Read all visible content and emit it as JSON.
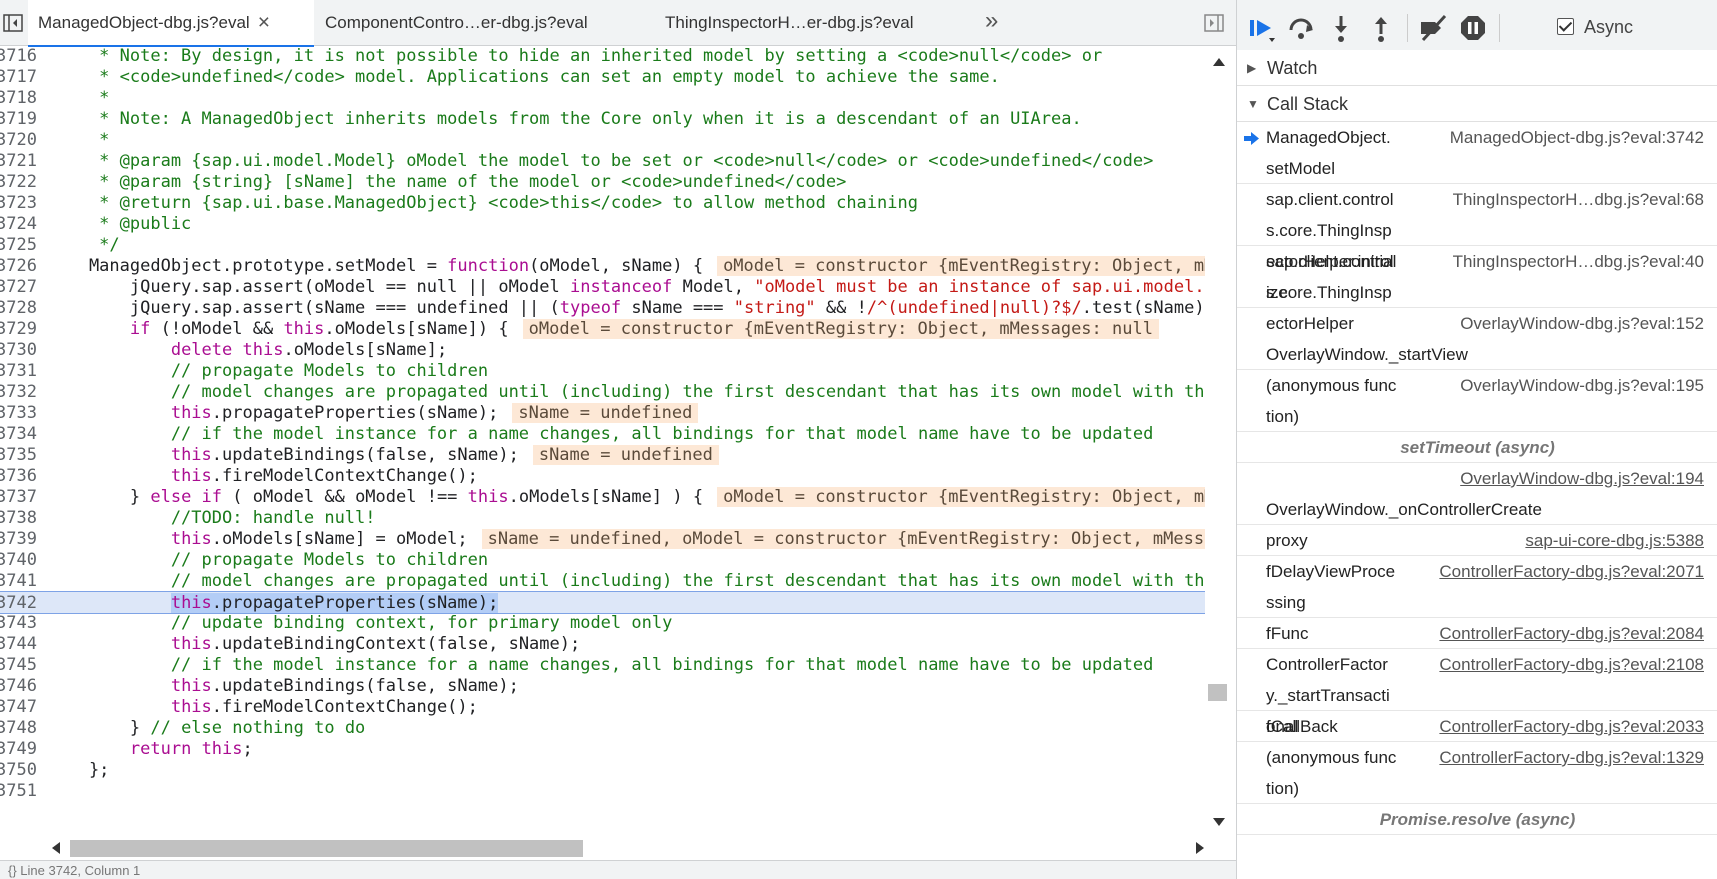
{
  "tabs": [
    {
      "label": "ManagedObject-dbg.js?eval",
      "active": true
    },
    {
      "label": "ComponentContro…er-dbg.js?eval",
      "active": false
    },
    {
      "label": "ThingInspectorH…er-dbg.js?eval",
      "active": false
    }
  ],
  "code": [
    {
      "n": "3716",
      "segs": [
        {
          "t": "     * Note: By design, it is not possible to hide an inherited model by setting a <code>null</code> or",
          "c": "cm"
        }
      ]
    },
    {
      "n": "3717",
      "segs": [
        {
          "t": "     * <code>undefined</code> model. Applications can set an empty model to achieve the same.",
          "c": "cm"
        }
      ]
    },
    {
      "n": "3718",
      "segs": [
        {
          "t": "     *",
          "c": "cm"
        }
      ]
    },
    {
      "n": "3719",
      "segs": [
        {
          "t": "     * Note: A ManagedObject inherits models from the Core only when it is a descendant of an UIArea.",
          "c": "cm"
        }
      ]
    },
    {
      "n": "3720",
      "segs": [
        {
          "t": "     *",
          "c": "cm"
        }
      ]
    },
    {
      "n": "3721",
      "segs": [
        {
          "t": "     * @param {sap.ui.model.Model} oModel the model to be set or <code>null</code> or <code>undefined</code>",
          "c": "cm"
        }
      ]
    },
    {
      "n": "3722",
      "segs": [
        {
          "t": "     * @param {string} [sName] the name of the model or <code>undefined</code>",
          "c": "cm"
        }
      ]
    },
    {
      "n": "3723",
      "segs": [
        {
          "t": "     * @return {sap.ui.base.ManagedObject} <code>this</code> to allow method chaining",
          "c": "cm"
        }
      ]
    },
    {
      "n": "3724",
      "segs": [
        {
          "t": "     * @public",
          "c": "cm"
        }
      ]
    },
    {
      "n": "3725",
      "segs": [
        {
          "t": "     */",
          "c": "cm"
        }
      ]
    },
    {
      "n": "3726",
      "segs": [
        {
          "t": "    ManagedObject.prototype.setModel = ",
          "c": ""
        },
        {
          "t": "function",
          "c": "kw"
        },
        {
          "t": "(oModel, sName) {",
          "c": ""
        }
      ],
      "val": "oModel = constructor {mEventRegistry: Object, mMessages: null"
    },
    {
      "n": "3727",
      "segs": [
        {
          "t": "        jQuery.sap.assert(oModel == null || oModel ",
          "c": ""
        },
        {
          "t": "instanceof",
          "c": "kw"
        },
        {
          "t": " Model, ",
          "c": ""
        },
        {
          "t": "\"oModel must be an instance of sap.ui.model.Model\"",
          "c": "str"
        }
      ]
    },
    {
      "n": "3728",
      "segs": [
        {
          "t": "        jQuery.sap.assert(sName === undefined || (",
          "c": ""
        },
        {
          "t": "typeof",
          "c": "kw"
        },
        {
          "t": " sName === ",
          "c": ""
        },
        {
          "t": "\"string\"",
          "c": "str"
        },
        {
          "t": " && !",
          "c": ""
        },
        {
          "t": "/^(undefined|null)?$/",
          "c": "str"
        },
        {
          "t": ".test(sName))",
          "c": ""
        }
      ]
    },
    {
      "n": "3729",
      "segs": [
        {
          "t": "        ",
          "c": ""
        },
        {
          "t": "if",
          "c": "kw"
        },
        {
          "t": " (!oModel && ",
          "c": ""
        },
        {
          "t": "this",
          "c": "kw"
        },
        {
          "t": ".oModels[sName]) {",
          "c": ""
        }
      ],
      "val": "oModel = constructor {mEventRegistry: Object, mMessages: null"
    },
    {
      "n": "3730",
      "segs": [
        {
          "t": "            ",
          "c": ""
        },
        {
          "t": "delete",
          "c": "kw"
        },
        {
          "t": " ",
          "c": ""
        },
        {
          "t": "this",
          "c": "kw"
        },
        {
          "t": ".oModels[sName];",
          "c": ""
        }
      ]
    },
    {
      "n": "3731",
      "segs": [
        {
          "t": "            // propagate Models to children",
          "c": "cm"
        }
      ]
    },
    {
      "n": "3732",
      "segs": [
        {
          "t": "            // model changes are propagated until (including) the first descendant that has its own model with the same name",
          "c": "cm"
        }
      ]
    },
    {
      "n": "3733",
      "segs": [
        {
          "t": "            ",
          "c": ""
        },
        {
          "t": "this",
          "c": "kw"
        },
        {
          "t": ".propagateProperties(sName);",
          "c": ""
        }
      ],
      "val": "sName = undefined"
    },
    {
      "n": "3734",
      "segs": [
        {
          "t": "            // if the model instance for a name changes, all bindings for that model name have to be updated",
          "c": "cm"
        }
      ]
    },
    {
      "n": "3735",
      "segs": [
        {
          "t": "            ",
          "c": ""
        },
        {
          "t": "this",
          "c": "kw"
        },
        {
          "t": ".updateBindings(false, sName);",
          "c": ""
        }
      ],
      "val": "sName = undefined"
    },
    {
      "n": "3736",
      "segs": [
        {
          "t": "            ",
          "c": ""
        },
        {
          "t": "this",
          "c": "kw"
        },
        {
          "t": ".fireModelContextChange();",
          "c": ""
        }
      ]
    },
    {
      "n": "3737",
      "segs": [
        {
          "t": "        } ",
          "c": ""
        },
        {
          "t": "else if",
          "c": "kw"
        },
        {
          "t": " ( oModel && oModel !== ",
          "c": ""
        },
        {
          "t": "this",
          "c": "kw"
        },
        {
          "t": ".oModels[sName] ) {",
          "c": ""
        }
      ],
      "val": "oModel = constructor {mEventRegistry: Object, mMessages: null"
    },
    {
      "n": "3738",
      "segs": [
        {
          "t": "            //TODO: handle null!",
          "c": "cm"
        }
      ]
    },
    {
      "n": "3739",
      "segs": [
        {
          "t": "            ",
          "c": ""
        },
        {
          "t": "this",
          "c": "kw"
        },
        {
          "t": ".oModels[sName] = oModel;",
          "c": ""
        }
      ],
      "val": "sName = undefined, oModel = constructor {mEventRegistry: Object, mMessages: null"
    },
    {
      "n": "3740",
      "segs": [
        {
          "t": "            // propagate Models to children",
          "c": "cm"
        }
      ]
    },
    {
      "n": "3741",
      "segs": [
        {
          "t": "            // model changes are propagated until (including) the first descendant that has its own model with the same name",
          "c": "cm"
        }
      ]
    },
    {
      "n": "3742",
      "exec": true,
      "segs": [
        {
          "t": "            ",
          "c": ""
        },
        {
          "t": "this",
          "c": "kw hl"
        },
        {
          "t": ".propagateProperties(sName);",
          "c": "hl"
        }
      ]
    },
    {
      "n": "3743",
      "segs": [
        {
          "t": "            // update binding context, for primary model only",
          "c": "cm"
        }
      ]
    },
    {
      "n": "3744",
      "segs": [
        {
          "t": "            ",
          "c": ""
        },
        {
          "t": "this",
          "c": "kw"
        },
        {
          "t": ".updateBindingContext(false, sName);",
          "c": ""
        }
      ]
    },
    {
      "n": "3745",
      "segs": [
        {
          "t": "            // if the model instance for a name changes, all bindings for that model name have to be updated",
          "c": "cm"
        }
      ]
    },
    {
      "n": "3746",
      "segs": [
        {
          "t": "            ",
          "c": ""
        },
        {
          "t": "this",
          "c": "kw"
        },
        {
          "t": ".updateBindings(false, sName);",
          "c": ""
        }
      ]
    },
    {
      "n": "3747",
      "segs": [
        {
          "t": "            ",
          "c": ""
        },
        {
          "t": "this",
          "c": "kw"
        },
        {
          "t": ".fireModelContextChange();",
          "c": ""
        }
      ]
    },
    {
      "n": "3748",
      "segs": [
        {
          "t": "        } ",
          "c": ""
        },
        {
          "t": "// else nothing to do",
          "c": "cm"
        }
      ]
    },
    {
      "n": "3749",
      "segs": [
        {
          "t": "        ",
          "c": ""
        },
        {
          "t": "return",
          "c": "kw"
        },
        {
          "t": " ",
          "c": ""
        },
        {
          "t": "this",
          "c": "kw"
        },
        {
          "t": ";",
          "c": ""
        }
      ]
    },
    {
      "n": "3750",
      "segs": [
        {
          "t": "    };",
          "c": ""
        }
      ]
    },
    {
      "n": "3751",
      "segs": [
        {
          "t": "",
          "c": ""
        }
      ]
    }
  ],
  "status_text": "{}  Line 3742, Column 1",
  "debugger": {
    "async_label": "Async",
    "async_checked": true,
    "watch_label": "Watch",
    "callstack_label": "Call Stack"
  },
  "callstack": [
    {
      "kind": "frame",
      "fn": "ManagedObject.setModel",
      "loc": "ManagedObject-dbg.js?eval:3742",
      "link": false,
      "current": true,
      "rows": 2
    },
    {
      "kind": "frame",
      "fn": "sap.client.controls.core.ThingInspectorHelper.initialize",
      "loc": "ThingInspectorH…dbg.js?eval:68",
      "link": false,
      "rows": 2
    },
    {
      "kind": "frame",
      "fn": "sap.client.controls.core.ThingInspectorHelper",
      "loc": "ThingInspectorH…dbg.js?eval:40",
      "link": false,
      "rows": 2
    },
    {
      "kind": "frame",
      "fn": "OverlayWindow._startView",
      "loc": "OverlayWindow-dbg.js?eval:152",
      "link": false,
      "rows": 2,
      "fn_below": true
    },
    {
      "kind": "frame",
      "fn": "(anonymous function)",
      "loc": "OverlayWindow-dbg.js?eval:195",
      "link": false,
      "rows": 2
    },
    {
      "kind": "sep",
      "label": "setTimeout (async)"
    },
    {
      "kind": "frame",
      "fn": "OverlayWindow._onControllerCreate",
      "loc": "OverlayWindow-dbg.js?eval:194",
      "link": true,
      "rows": 2,
      "fn_below": true
    },
    {
      "kind": "frame",
      "fn": "proxy",
      "loc": "sap-ui-core-dbg.js:5388",
      "link": true,
      "rows": 1
    },
    {
      "kind": "frame",
      "fn": "fDelayViewProcessing",
      "loc": "ControllerFactory-dbg.js?eval:2071",
      "link": true,
      "rows": 2
    },
    {
      "kind": "frame",
      "fn": "fFunc",
      "loc": "ControllerFactory-dbg.js?eval:2084",
      "link": true,
      "rows": 1
    },
    {
      "kind": "frame",
      "fn": "ControllerFactory._startTransactional",
      "loc": "ControllerFactory-dbg.js?eval:2108",
      "link": true,
      "rows": 2
    },
    {
      "kind": "frame",
      "fn": "fCallBack",
      "loc": "ControllerFactory-dbg.js?eval:2033",
      "link": true,
      "rows": 1
    },
    {
      "kind": "frame",
      "fn": "(anonymous function)",
      "loc": "ControllerFactory-dbg.js?eval:1329",
      "link": true,
      "rows": 2
    },
    {
      "kind": "sep",
      "label": "Promise.resolve (async)"
    }
  ]
}
